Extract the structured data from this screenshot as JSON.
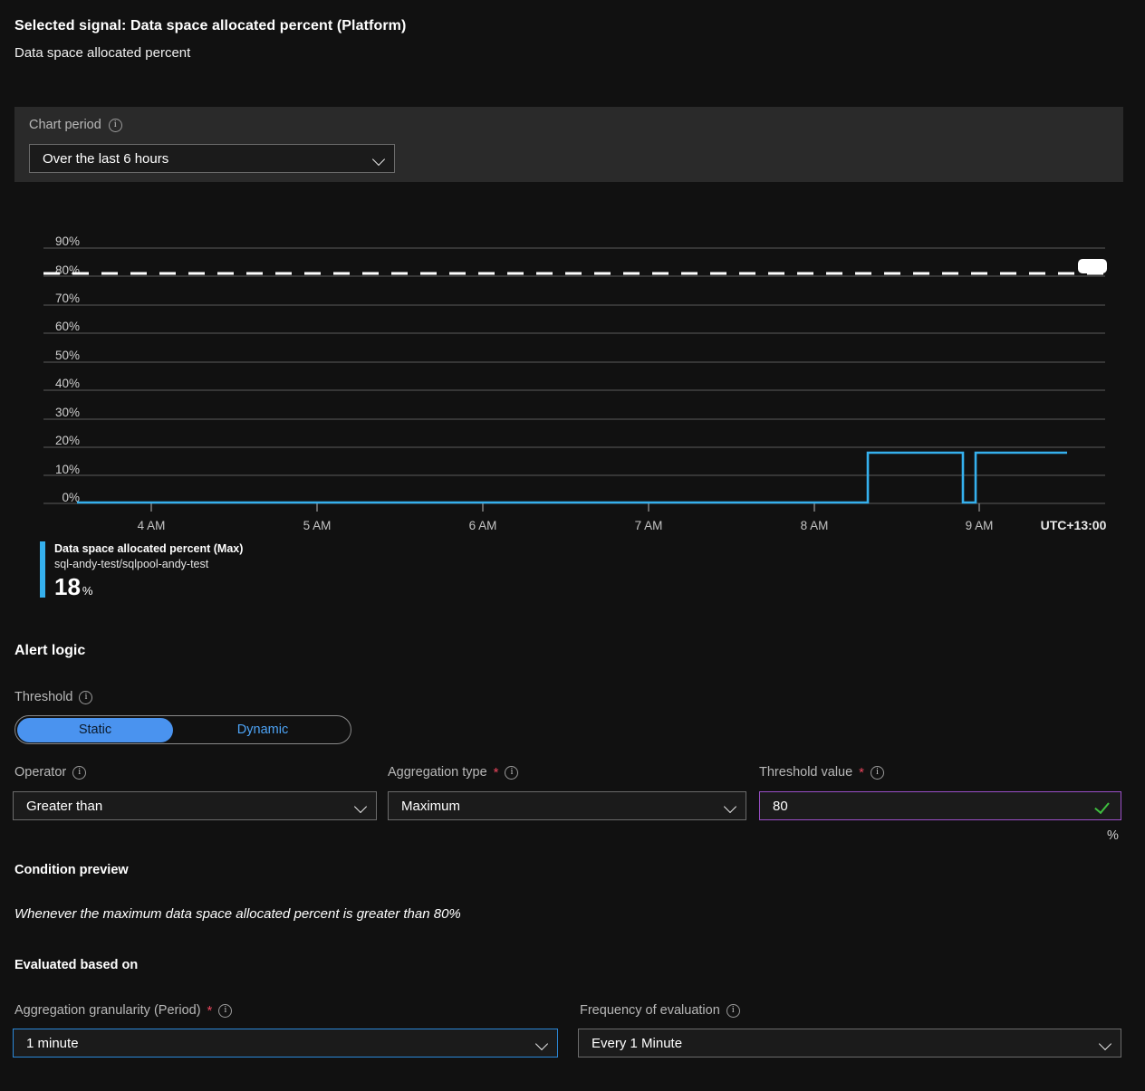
{
  "header": {
    "selected_signal": "Selected signal: Data space allocated percent (Platform)",
    "signal_name": "Data space allocated percent"
  },
  "chart_period": {
    "label": "Chart period",
    "info_icon": "info-icon",
    "selected": "Over the last 6 hours",
    "chevron_icon": "chevron-down-icon"
  },
  "legend": {
    "series_name": "Data space allocated percent (Max)",
    "resource": "sql-andy-test/sqlpool-andy-test",
    "value": "18",
    "unit": "%"
  },
  "alert_logic": {
    "heading": "Alert logic",
    "threshold_label": "Threshold",
    "threshold_options": [
      "Static",
      "Dynamic"
    ],
    "threshold_selected": "Static",
    "operator_label": "Operator",
    "operator_value": "Greater than",
    "aggregation_type_label": "Aggregation type",
    "aggregation_type_value": "Maximum",
    "threshold_value_label": "Threshold value",
    "threshold_value": "80",
    "threshold_unit": "%",
    "required_marker": "*"
  },
  "condition_preview": {
    "heading": "Condition preview",
    "text": "Whenever the maximum data space allocated percent is greater than 80%"
  },
  "evaluated_based_on": {
    "heading": "Evaluated based on",
    "granularity_label": "Aggregation granularity (Period)",
    "granularity_value": "1 minute",
    "frequency_label": "Frequency of evaluation",
    "frequency_value": "Every 1 Minute",
    "required_marker": "*"
  },
  "colors": {
    "accent_blue": "#35b0ed",
    "toggle_blue": "#4a93ef",
    "threshold_border": "#9b4fc8",
    "focus_border": "#2b88d8",
    "valid_check": "#3fbf3f",
    "required_red": "#e8455c",
    "panel_bg": "#2a2a2a",
    "page_bg": "#111111"
  },
  "chart_data": {
    "type": "line",
    "title": "Data space allocated percent",
    "xlabel": "",
    "ylabel": "",
    "timezone_label": "UTC+13:00",
    "ylim": [
      0,
      95
    ],
    "ytick_labels": [
      "0%",
      "10%",
      "20%",
      "30%",
      "40%",
      "50%",
      "60%",
      "70%",
      "80%",
      "90%"
    ],
    "ytick_values": [
      0,
      10,
      20,
      30,
      40,
      50,
      60,
      70,
      80,
      90
    ],
    "xtick_labels": [
      "4 AM",
      "5 AM",
      "6 AM",
      "7 AM",
      "8 AM",
      "9 AM"
    ],
    "grid": true,
    "legend_position": "bottom-left",
    "threshold_line": {
      "value": 80,
      "label": "80%",
      "style": "dashed",
      "color": "#ffffff",
      "handle": "threshold-drag-handle"
    },
    "series": [
      {
        "name": "Data space allocated percent (Max)",
        "resource": "sql-andy-test/sqlpool-andy-test",
        "color": "#35b0ed",
        "unit": "%",
        "x": [
          "3:25 AM",
          "4:00 AM",
          "5:00 AM",
          "6:00 AM",
          "7:00 AM",
          "8:00 AM",
          "8:26 AM",
          "8:27 AM",
          "9:01 AM",
          "9:02 AM",
          "9:03 AM",
          "9:04 AM",
          "9:45 AM"
        ],
        "values": [
          0,
          0,
          0,
          0,
          0,
          0,
          0,
          18,
          18,
          0,
          0,
          18,
          18
        ]
      }
    ]
  }
}
